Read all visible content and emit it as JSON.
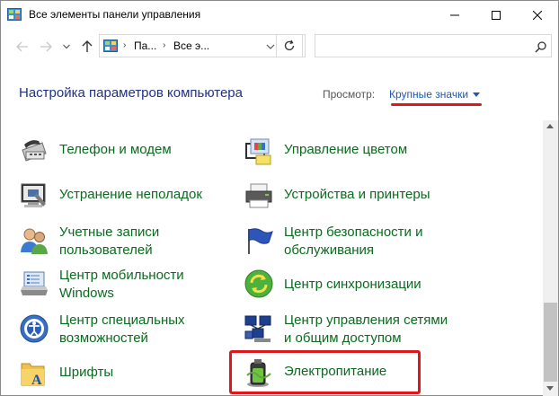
{
  "window": {
    "title": "Все элементы панели управления"
  },
  "address": {
    "crumbs": [
      "Па...",
      "Все э..."
    ],
    "separator": "›",
    "search_placeholder": ""
  },
  "header": {
    "title": "Настройка параметров компьютера",
    "view_label": "Просмотр:",
    "view_value": "Крупные значки"
  },
  "items": {
    "phone": {
      "label": "Телефон и модем",
      "icon": "phone-modem-icon"
    },
    "color": {
      "label": "Управление цветом",
      "icon": "color-management-icon"
    },
    "troubleshoot": {
      "label": "Устранение неполадок",
      "icon": "troubleshooting-icon"
    },
    "devices": {
      "label": "Устройства и принтеры",
      "icon": "devices-printers-icon"
    },
    "accounts": {
      "line1": "Учетные записи",
      "line2": "пользователей",
      "icon": "user-accounts-icon"
    },
    "security": {
      "line1": "Центр безопасности и",
      "line2": "обслуживания",
      "icon": "security-flag-icon"
    },
    "mobility": {
      "line1": "Центр мобильности",
      "line2": "Windows",
      "icon": "mobility-center-icon"
    },
    "sync": {
      "label": "Центр синхронизации",
      "icon": "sync-center-icon"
    },
    "ease": {
      "line1": "Центр специальных",
      "line2": "возможностей",
      "icon": "ease-of-access-icon"
    },
    "network": {
      "line1": "Центр управления сетями",
      "line2": "и общим доступом",
      "icon": "network-sharing-icon"
    },
    "fonts": {
      "label": "Шрифты",
      "icon": "fonts-folder-icon"
    },
    "power": {
      "label": "Электропитание",
      "icon": "power-options-icon"
    }
  },
  "colors": {
    "link_green": "#0a6a1e",
    "title_blue": "#1e3287",
    "highlight_red": "#e0161b"
  }
}
